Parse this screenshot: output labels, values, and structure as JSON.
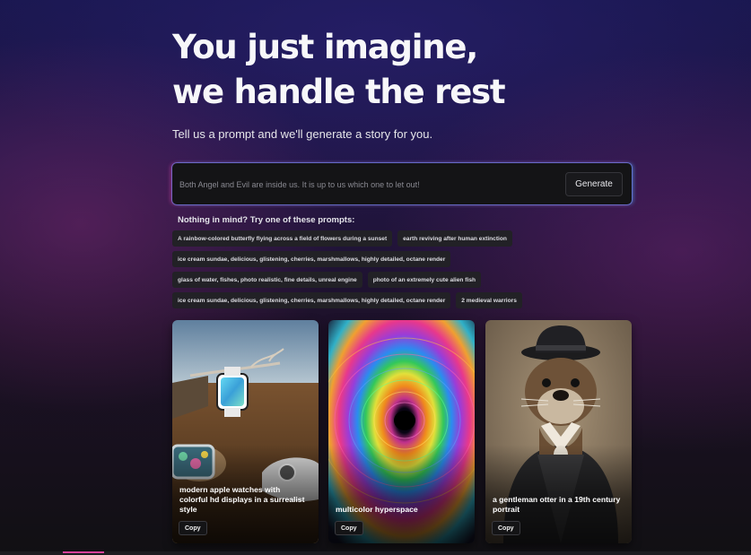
{
  "hero": {
    "title_line1": "You just imagine,",
    "title_line2": "we handle the rest",
    "subtitle": "Tell us a prompt and we'll generate a story for you."
  },
  "prompt": {
    "placeholder": "Both Angel and Evil are inside us. It is up to us which one to let out!",
    "value": "",
    "generate_label": "Generate"
  },
  "suggestions": {
    "label": "Nothing in mind? Try one of these prompts:",
    "rows": [
      [
        "A rainbow-colored butterfly flying across a field of flowers during a sunset",
        "earth reviving after human extinction"
      ],
      [
        "ice cream sundae, delicious, glistening, cherries, marshmallows, highly detailed, octane render"
      ],
      [
        "glass of water, fishes, photo realistic, fine details, unreal engine",
        "photo of an extremely cute alien fish"
      ],
      [
        "ice cream sundae, delicious, glistening, cherries, marshmallows, highly detailed, octane render",
        "2 medieval warriors"
      ]
    ]
  },
  "gallery": {
    "cards": [
      {
        "caption": "modern apple watches with colorful hd displays in a surrealist style",
        "copy_label": "Copy"
      },
      {
        "caption": "multicolor hyperspace",
        "copy_label": "Copy"
      },
      {
        "caption": "a gentleman otter in a 19th century portrait",
        "copy_label": "Copy"
      }
    ]
  },
  "colors": {
    "accent": "#d9419a",
    "prompt_glow_left": "#ff50b4",
    "prompt_glow_right": "#50b4ff"
  }
}
